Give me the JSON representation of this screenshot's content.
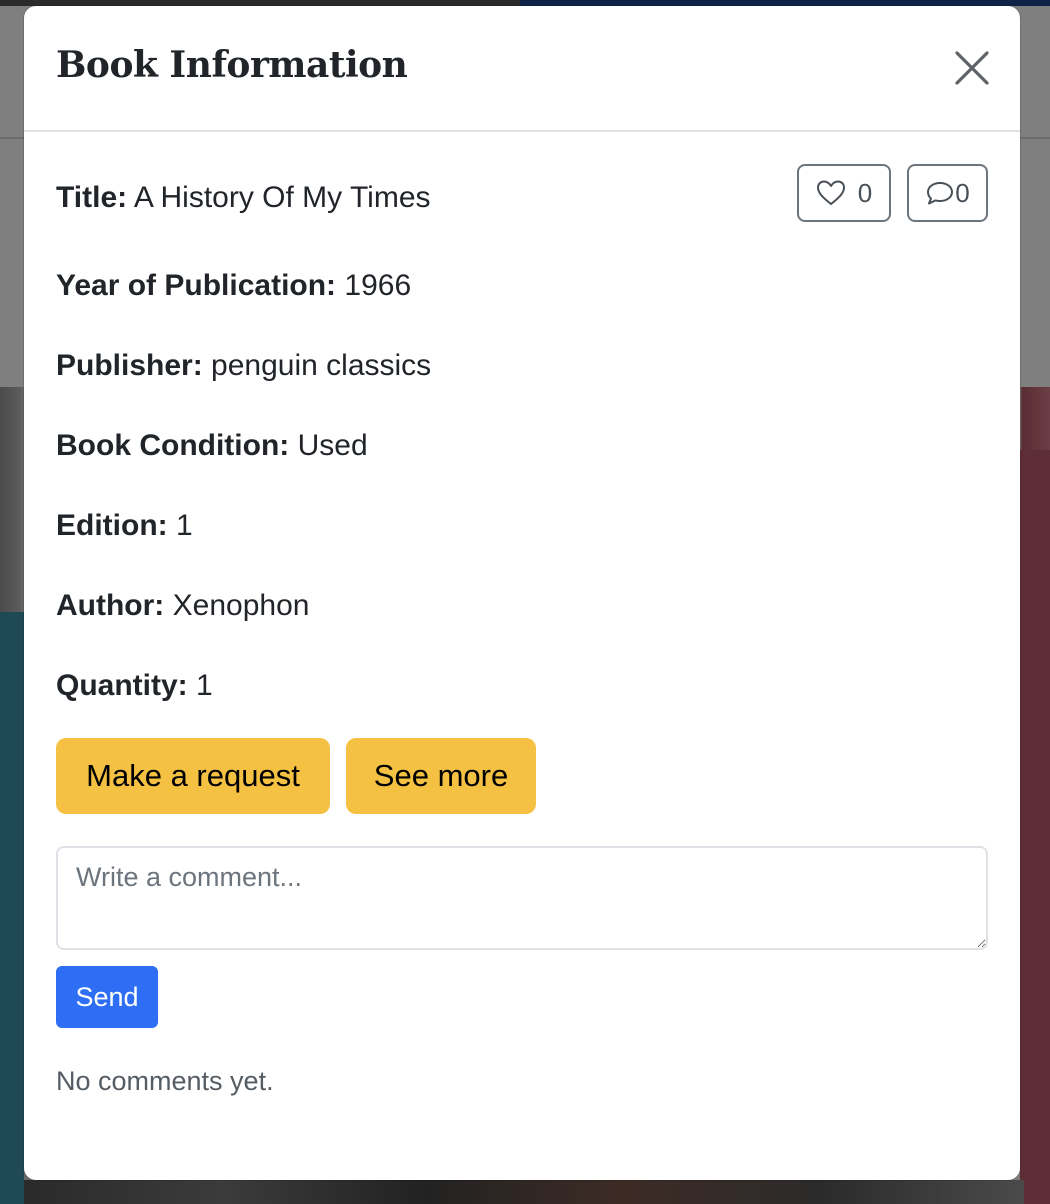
{
  "modal": {
    "title": "Book Information",
    "close_icon": "close-icon"
  },
  "book": {
    "fields": [
      {
        "label": "Title:",
        "value": "A History Of My Times"
      },
      {
        "label": "Year of Publication:",
        "value": "1966"
      },
      {
        "label": "Publisher:",
        "value": "penguin classics"
      },
      {
        "label": "Book Condition:",
        "value": "Used"
      },
      {
        "label": "Edition:",
        "value": "1"
      },
      {
        "label": "Author:",
        "value": "Xenophon"
      },
      {
        "label": "Quantity:",
        "value": "1"
      }
    ]
  },
  "stats": {
    "likes": "0",
    "comments": "0",
    "like_icon": "heart-icon",
    "comment_icon": "speech-bubble-icon"
  },
  "actions": {
    "request_label": "Make a request",
    "see_more_label": "See more",
    "button_color": "#f4c142"
  },
  "comment": {
    "placeholder": "Write a comment...",
    "send_label": "Send",
    "send_color": "#2d6ef5",
    "empty_text": "No comments yet."
  }
}
